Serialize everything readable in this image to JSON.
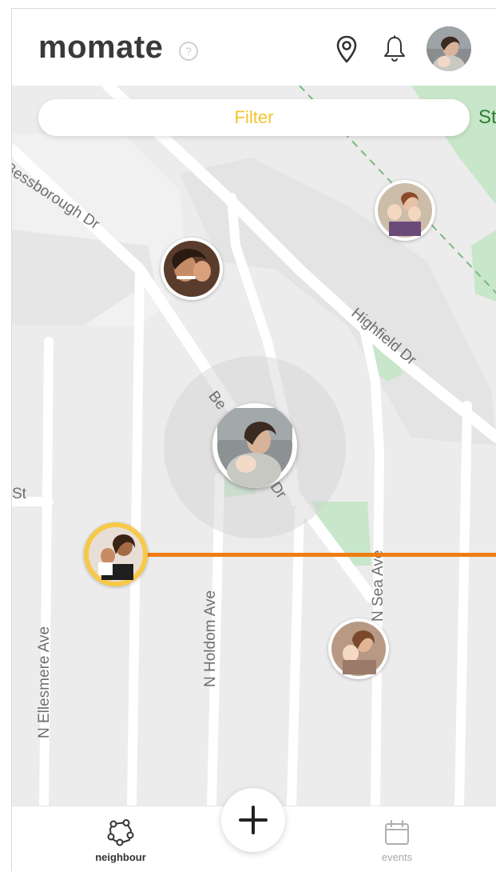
{
  "app": {
    "title": "momate"
  },
  "header": {
    "help_icon": "question-circle-icon",
    "location_icon": "map-pin-icon",
    "notifications_icon": "bell-icon",
    "profile_avatar": "user-avatar"
  },
  "map": {
    "filter_label": "Filter",
    "edge_label": "St",
    "streets": [
      "Bessborough Dr",
      "Highfield Dr",
      "Be",
      "Dr",
      "St",
      "N Sea Ave",
      "N Holdom Ave",
      "N Ellesmere Ave"
    ]
  },
  "bottom_nav": {
    "items": [
      {
        "label": "neighbour",
        "icon": "neighbour-icon",
        "active": true
      },
      {
        "label": "events",
        "icon": "calendar-icon",
        "active": false
      }
    ],
    "add_icon": "plus-icon"
  },
  "colors": {
    "brand_text": "#3a3a3a",
    "filter_text": "#f4c430",
    "route_line": "#f07d12",
    "highlight_ring": "#f7c948",
    "park_green": "#c8e6c9",
    "active_nav": "#333333",
    "inactive_nav": "#a8a8a8"
  }
}
